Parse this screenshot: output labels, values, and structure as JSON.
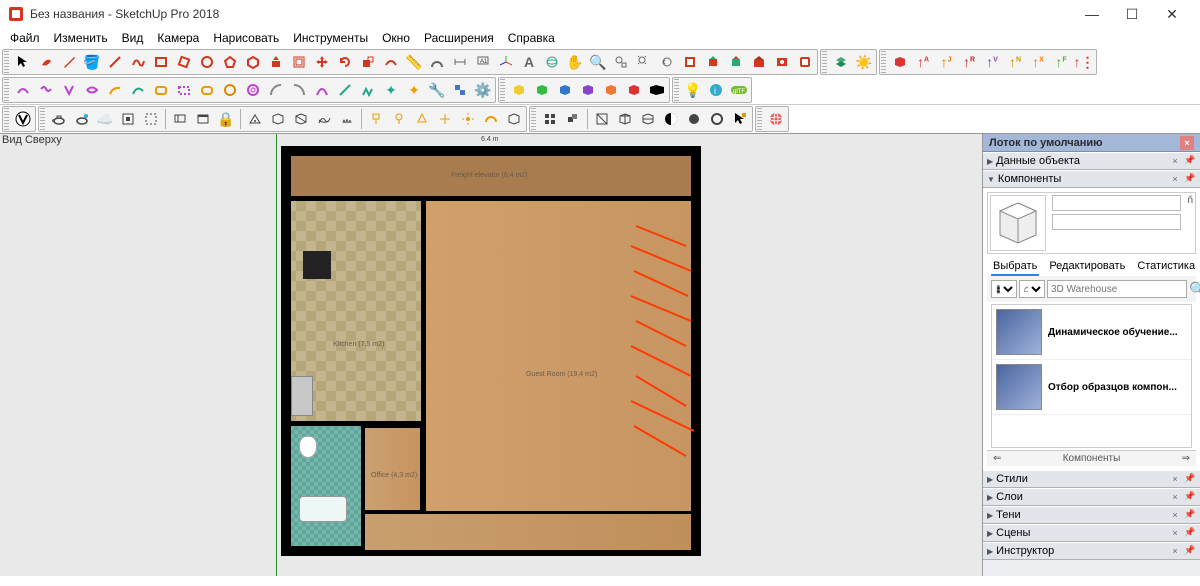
{
  "window": {
    "title": "Без названия - SketchUp Pro 2018"
  },
  "win_controls": {
    "min": "—",
    "max": "☐",
    "close": "✕"
  },
  "menu": [
    "Файл",
    "Изменить",
    "Вид",
    "Камера",
    "Нарисовать",
    "Инструменты",
    "Окно",
    "Расширения",
    "Справка"
  ],
  "view_label": "Вид Сверху",
  "toolbar_row1": [
    [
      "select",
      "eraser",
      "pencil",
      "palette",
      "line",
      "freehand",
      "rect",
      "rect-rot",
      "circle",
      "polygon",
      "polygon2",
      "pushpull",
      "offset",
      "move",
      "rotate",
      "scale",
      "followme",
      "tape",
      "protractor",
      "ruler",
      "text",
      "axes",
      "3dtext",
      "orbit",
      "pan",
      "zoom",
      "zoom-window",
      "zoom-extents",
      "prev",
      "section",
      "get-models",
      "share",
      "3dwarehouse",
      "ext-warehouse",
      "warning"
    ],
    [
      "layers",
      "sun",
      "sep"
    ],
    [
      "red-cube",
      "arrow-up-r",
      "arrow-up-g",
      "arrow-up-b",
      "arrow-up-y",
      "arrow-up-o",
      "arrow-up-c",
      "arrow-up-m",
      "arrow-dots"
    ]
  ],
  "toolbar_row2": [
    [
      "arc",
      "arc2",
      "arc3",
      "arc4",
      "arc5",
      "arc6",
      "rect-o",
      "rect-o2",
      "rect-o3",
      "orbit-col",
      "orbit-col2",
      "shade",
      "shade2",
      "shade3",
      "comp",
      "comp2",
      "comp3",
      "undo",
      "redo",
      "star",
      "settings",
      "cfg"
    ],
    [
      "cube-y",
      "cube-b",
      "cube-g",
      "cube-r",
      "cube-m",
      "cube-o",
      "cube-black"
    ],
    [
      "bulb",
      "info",
      "glTF"
    ]
  ],
  "toolbar_row3": [
    [
      "v-ray"
    ],
    [
      "teapot",
      "teapot-rt",
      "cloud",
      "render",
      "region",
      "sep",
      "viewport",
      "monitor",
      "lock",
      "sep",
      "camera",
      "cube-w",
      "cube-d",
      "mesh",
      "waves",
      "sep",
      "light-d",
      "light-o",
      "light-s",
      "light-p",
      "light-a",
      "dome",
      "cube-gl"
    ],
    [
      "grid",
      "cubes",
      "sep",
      "section-p",
      "wire",
      "wire2",
      "checker",
      "sphere",
      "sphere2",
      "arrow-app"
    ],
    [
      "globe"
    ]
  ],
  "tray": {
    "title": "Лоток по умолчанию",
    "panels": [
      {
        "name": "Данные объекта",
        "expanded": false
      },
      {
        "name": "Компоненты",
        "expanded": true
      },
      {
        "name": "Стили",
        "expanded": false
      },
      {
        "name": "Слои",
        "expanded": false
      },
      {
        "name": "Тени",
        "expanded": false
      },
      {
        "name": "Сцены",
        "expanded": false
      },
      {
        "name": "Инструктор",
        "expanded": false
      }
    ],
    "components": {
      "tabs": [
        "Выбрать",
        "Редактировать",
        "Статистика"
      ],
      "active_tab": 0,
      "search_placeholder": "3D Warehouse",
      "items": [
        {
          "label": "Динамическое обучение..."
        },
        {
          "label": "Отбор образцов компон..."
        }
      ],
      "nav_label": "Компоненты",
      "nav_prev": "⇐",
      "nav_next": "⇒"
    }
  },
  "floorplan": {
    "top_dim": "6.4 m",
    "rooms": {
      "freight": "Freight elevator (6,4 m2)",
      "kitchen": "Kitchen (7,5 m2)",
      "guest": "Guest Room (19,4 m2)",
      "office": "Office (4,3 m2)"
    }
  },
  "icons": {
    "sketchup": "▣"
  }
}
